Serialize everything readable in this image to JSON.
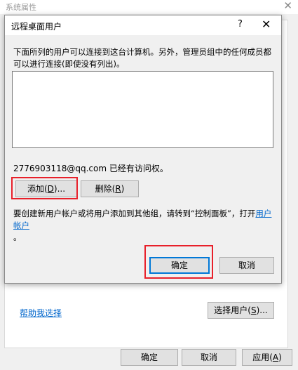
{
  "parent_window": {
    "title": "系统属性",
    "close_glyph": "✕",
    "help_link": "帮助我选择",
    "select_users_label": "选择用户(",
    "select_users_accel": "S",
    "select_users_suffix": ")...",
    "ok_label": "确定",
    "cancel_label": "取消",
    "apply_label": "应用(",
    "apply_accel": "A",
    "apply_suffix": ")"
  },
  "dialog": {
    "title": "远程桌面用户",
    "help_glyph": "?",
    "close_glyph": "✕",
    "description": "下面所列的用户可以连接到这台计算机。另外，管理员组中的任何成员都可以进行连接(即使没有列出)。",
    "user_list": [],
    "access_text": "2776903118@qq.com 已经有访问权。",
    "add_label": "添加(",
    "add_accel": "D",
    "add_suffix": ")...",
    "remove_label": "删除(",
    "remove_accel": "R",
    "remove_suffix": ")",
    "hint_text": "要创建新用户帐户或将用户添加到其他组，请转到“控制面板”，打开",
    "hint_link": "用户帐户",
    "hint_end": "。",
    "ok_label": "确定",
    "cancel_label": "取消"
  },
  "colors": {
    "highlight": "#e8202a",
    "link": "#0066cc",
    "focus_border": "#0078d7"
  },
  "icons": {
    "parent_close": "close-icon",
    "dialog_close": "close-icon",
    "dialog_help": "help-icon"
  }
}
